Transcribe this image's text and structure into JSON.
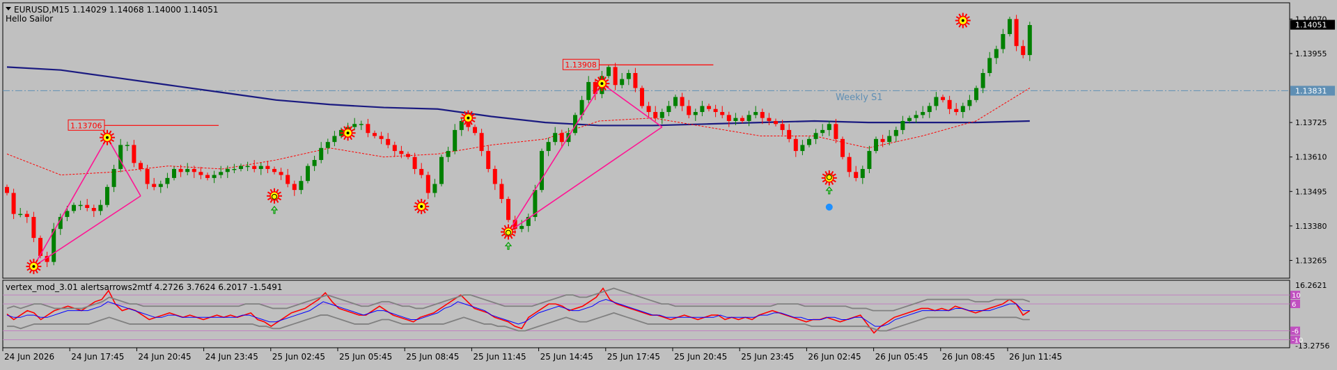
{
  "header": {
    "symbol_line": "EURUSD,M15  1.14029 1.14068 1.14000 1.14051",
    "subtitle": "Hello Sailor"
  },
  "colors": {
    "background": "#c0c0c0",
    "bull": "#008000",
    "bear": "#ff0000",
    "ma_long": "#1a1a80",
    "ma_short_dashed": "#ff0000",
    "zigzag": "#ff1493",
    "pivot_line": "#5f8fb4",
    "current_price_bg": "#000000",
    "osc_red": "#ff0000",
    "osc_blue": "#0000ff",
    "osc_band": "#808080",
    "osc_level": "#c080c0"
  },
  "chart_data": [
    {
      "type": "candlestick",
      "title": "EURUSD,M15",
      "ohlc_last": {
        "open": 1.14029,
        "high": 1.14068,
        "low": 1.14,
        "close": 1.14051
      },
      "y_ticks": [
        1.1407,
        1.13955,
        1.13725,
        1.1361,
        1.13495,
        1.1338,
        1.13265
      ],
      "y_tick_labels": [
        "1.14070",
        "1.13955",
        "1.13725",
        "1.13610",
        "1.13495",
        "1.13380",
        "1.13265"
      ],
      "ylim": [
        1.13215,
        1.14115
      ],
      "x_tick_labels": [
        "24 Jun 2026",
        "24 Jun 17:45",
        "24 Jun 20:45",
        "24 Jun 23:45",
        "25 Jun 02:45",
        "25 Jun 05:45",
        "25 Jun 08:45",
        "25 Jun 11:45",
        "25 Jun 14:45",
        "25 Jun 17:45",
        "25 Jun 20:45",
        "25 Jun 23:45",
        "26 Jun 02:45",
        "26 Jun 05:45",
        "26 Jun 08:45",
        "26 Jun 11:45"
      ],
      "current_price": 1.14051,
      "current_price_label": "1.14051",
      "pivot": {
        "label": "Weekly S1",
        "value": 1.13831,
        "value_label": "1.13831"
      },
      "price_labels": [
        {
          "text": "1.13706",
          "value": 1.13706,
          "bar": 15
        },
        {
          "text": "1.13908",
          "value": 1.13908,
          "bar": 89
        }
      ],
      "series": [
        {
          "name": "close",
          "values": [
            1.1349,
            1.1342,
            1.1342,
            1.1341,
            1.1334,
            1.1328,
            1.1326,
            1.1337,
            1.1341,
            1.1343,
            1.1345,
            1.1345,
            1.1344,
            1.1343,
            1.1345,
            1.1351,
            1.1357,
            1.1365,
            1.1365,
            1.1359,
            1.1357,
            1.1352,
            1.1351,
            1.1352,
            1.1354,
            1.1357,
            1.1356,
            1.1357,
            1.1356,
            1.1355,
            1.1354,
            1.1355,
            1.1356,
            1.1357,
            1.1357,
            1.1358,
            1.1358,
            1.1357,
            1.1358,
            1.1357,
            1.1356,
            1.1355,
            1.1352,
            1.135,
            1.1353,
            1.1358,
            1.136,
            1.1364,
            1.1366,
            1.1368,
            1.137,
            1.1371,
            1.1372,
            1.1372,
            1.1369,
            1.1368,
            1.1367,
            1.1365,
            1.1363,
            1.1362,
            1.1361,
            1.1357,
            1.1355,
            1.1349,
            1.1352,
            1.1361,
            1.1363,
            1.137,
            1.1373,
            1.1371,
            1.1369,
            1.1363,
            1.1357,
            1.1352,
            1.1347,
            1.134,
            1.1337,
            1.1338,
            1.1341,
            1.135,
            1.1363,
            1.1366,
            1.1369,
            1.1366,
            1.1369,
            1.1375,
            1.138,
            1.1386,
            1.1382,
            1.1388,
            1.1391,
            1.1385,
            1.1387,
            1.1389,
            1.1384,
            1.1378,
            1.1376,
            1.1374,
            1.1376,
            1.1378,
            1.1381,
            1.1378,
            1.1375,
            1.1376,
            1.1378,
            1.1377,
            1.1376,
            1.1375,
            1.1373,
            1.1374,
            1.1373,
            1.1375,
            1.1376,
            1.1374,
            1.1373,
            1.1372,
            1.137,
            1.1367,
            1.1363,
            1.1365,
            1.1367,
            1.1369,
            1.137,
            1.1372,
            1.1367,
            1.1361,
            1.1356,
            1.1354,
            1.1357,
            1.1363,
            1.1367,
            1.1366,
            1.1368,
            1.137,
            1.1373,
            1.1374,
            1.1375,
            1.1376,
            1.1378,
            1.1381,
            1.138,
            1.1377,
            1.1376,
            1.1378,
            1.138,
            1.1384,
            1.1389,
            1.1394,
            1.1397,
            1.1402,
            1.1407,
            1.1398,
            1.1395,
            1.1405
          ]
        }
      ],
      "ma_long": {
        "values": [
          1.1391,
          1.139,
          1.13875,
          1.1385,
          1.13825,
          1.138,
          1.13785,
          1.13775,
          1.1377,
          1.13745,
          1.13725,
          1.13715,
          1.13715,
          1.1372,
          1.13725,
          1.1373,
          1.13725,
          1.13725,
          1.13725,
          1.1373
        ]
      },
      "ma_short": {
        "values": [
          1.1362,
          1.1355,
          1.1356,
          1.1358,
          1.1357,
          1.136,
          1.1364,
          1.1361,
          1.1362,
          1.1365,
          1.1367,
          1.1373,
          1.1374,
          1.1371,
          1.1368,
          1.1368,
          1.1364,
          1.1368,
          1.1373,
          1.1384
        ]
      },
      "zigzag": [
        {
          "bar": 4,
          "value": 1.13245
        },
        {
          "bar": 15,
          "value": 1.13675
        },
        {
          "bar": 20,
          "value": 1.1348
        },
        {
          "bar": 4,
          "value": 1.13245
        },
        {
          "bar": 75,
          "value": 1.1336
        },
        {
          "bar": 89,
          "value": 1.13855
        },
        {
          "bar": 98,
          "value": 1.1371
        },
        {
          "bar": 75,
          "value": 1.1336
        }
      ],
      "signal_markers": [
        {
          "kind": "low",
          "bar": 4,
          "value": 1.13245
        },
        {
          "kind": "high",
          "bar": 15,
          "value": 1.13675
        },
        {
          "kind": "low",
          "bar": 40,
          "value": 1.1348
        },
        {
          "kind": "high",
          "bar": 51,
          "value": 1.1369
        },
        {
          "kind": "low",
          "bar": 62,
          "value": 1.13445
        },
        {
          "kind": "high",
          "bar": 69,
          "value": 1.1374
        },
        {
          "kind": "low",
          "bar": 75,
          "value": 1.1336
        },
        {
          "kind": "high",
          "bar": 89,
          "value": 1.13855
        },
        {
          "kind": "low",
          "bar": 123,
          "value": 1.1354
        },
        {
          "kind": "high",
          "bar": 143,
          "value": 1.14065
        }
      ],
      "up_arrows": [
        {
          "bar": 40,
          "value": 1.13445
        },
        {
          "bar": 75,
          "value": 1.13325
        },
        {
          "bar": 123,
          "value": 1.1351
        }
      ],
      "blue_dot": {
        "bar": 123,
        "value": 1.1348
      }
    },
    {
      "type": "line",
      "title": "vertex_mod_3.01 alertsarrows2mtf 4.2726 3.7624 6.2017 -1.5491",
      "y_tick_labels": [
        "16.2621",
        "-13.2756"
      ],
      "ylim": [
        -13.2756,
        16.2621
      ],
      "levels": [
        10,
        6,
        -6,
        -10
      ],
      "level_labels": [
        "10",
        "6",
        "-6",
        "-10"
      ],
      "series": [
        {
          "values": [
            1.5,
            -1,
            1,
            3,
            2,
            -1,
            1,
            3,
            4,
            5,
            4,
            3,
            5,
            7,
            8,
            12,
            6,
            3,
            4,
            3,
            1,
            -1,
            0,
            1,
            2,
            1,
            0,
            1,
            0,
            -1,
            0,
            1,
            0,
            1,
            0,
            1,
            2,
            -1,
            -2,
            -4,
            -2,
            0,
            2,
            3,
            4,
            6,
            8,
            11,
            7,
            4,
            3,
            2,
            1,
            1,
            3,
            5,
            3,
            1,
            0,
            -1,
            -2,
            0,
            1,
            2,
            4,
            6,
            8,
            10,
            7,
            4,
            3,
            2,
            0,
            -1,
            -2,
            -4,
            -5,
            0,
            2,
            4,
            6,
            6,
            5,
            3,
            4,
            5,
            7,
            9,
            13,
            8,
            6,
            5,
            4,
            3,
            2,
            1,
            1,
            0,
            -1,
            0,
            1,
            0,
            -1,
            0,
            1,
            1,
            -1,
            0,
            -1,
            0,
            -1,
            1,
            2,
            3,
            2,
            1,
            0,
            -1,
            -2,
            -1,
            -1,
            0,
            -1,
            -2,
            -1,
            0,
            1,
            -3,
            -7,
            -4,
            -2,
            0,
            1,
            2,
            3,
            4,
            4,
            3,
            4,
            3,
            5,
            4,
            3,
            2,
            3,
            4,
            5,
            6,
            8,
            6,
            1,
            3
          ]
        },
        {
          "values": [
            1,
            0,
            0,
            1,
            1,
            0,
            0,
            1,
            2,
            3,
            3,
            3,
            3,
            4,
            5,
            7,
            6,
            5,
            4,
            3,
            2,
            1,
            0,
            0,
            1,
            1,
            0,
            0,
            0,
            0,
            0,
            0,
            0,
            0,
            0,
            1,
            1,
            0,
            -1,
            -2,
            -2,
            -1,
            0,
            1,
            2,
            3,
            5,
            7,
            6,
            5,
            4,
            3,
            2,
            1,
            2,
            3,
            3,
            2,
            1,
            0,
            -1,
            -1,
            0,
            1,
            2,
            4,
            5,
            7,
            6,
            5,
            4,
            3,
            1,
            0,
            -1,
            -2,
            -3,
            -2,
            0,
            2,
            3,
            4,
            5,
            4,
            3,
            3,
            4,
            5,
            7,
            8,
            7,
            6,
            5,
            4,
            3,
            2,
            1,
            1,
            0,
            0,
            0,
            0,
            0,
            0,
            0,
            0,
            1,
            0,
            0,
            0,
            0,
            0,
            1,
            1,
            2,
            2,
            1,
            0,
            0,
            -1,
            -1,
            -1,
            0,
            0,
            -1,
            -1,
            0,
            0,
            -2,
            -4,
            -4,
            -3,
            -1,
            0,
            1,
            2,
            3,
            3,
            3,
            3,
            3,
            4,
            4,
            3,
            3,
            3,
            3,
            4,
            5,
            6,
            6,
            3,
            3
          ]
        },
        {
          "values": [
            4,
            5,
            4,
            5,
            6,
            6,
            5,
            4,
            4,
            4,
            4,
            4,
            5,
            6,
            7,
            9,
            8,
            7,
            6,
            6,
            5,
            5,
            5,
            5,
            5,
            5,
            5,
            5,
            5,
            5,
            5,
            5,
            5,
            5,
            5,
            6,
            6,
            6,
            5,
            4,
            4,
            4,
            5,
            6,
            7,
            8,
            9,
            10,
            9,
            8,
            7,
            6,
            5,
            5,
            6,
            7,
            7,
            6,
            5,
            5,
            4,
            4,
            5,
            6,
            7,
            8,
            9,
            10,
            10,
            9,
            8,
            7,
            6,
            5,
            5,
            5,
            5,
            5,
            6,
            7,
            8,
            9,
            10,
            10,
            9,
            9,
            10,
            11,
            12,
            13,
            12,
            11,
            10,
            9,
            8,
            7,
            6,
            6,
            5,
            5,
            5,
            5,
            5,
            5,
            5,
            5,
            5,
            5,
            5,
            5,
            5,
            5,
            5,
            6,
            6,
            6,
            6,
            5,
            5,
            5,
            5,
            5,
            5,
            5,
            4,
            4,
            4,
            3,
            3,
            3,
            3,
            4,
            5,
            6,
            7,
            8,
            8,
            8,
            8,
            8,
            8,
            8,
            7,
            7,
            7,
            8,
            8,
            8,
            8,
            8,
            7
          ]
        },
        {
          "values": [
            -4,
            -4,
            -5,
            -4,
            -3,
            -3,
            -3,
            -3,
            -3,
            -3,
            -3,
            -3,
            -3,
            -2,
            -1,
            0,
            -1,
            -2,
            -3,
            -3,
            -3,
            -3,
            -3,
            -3,
            -3,
            -3,
            -3,
            -3,
            -3,
            -3,
            -3,
            -3,
            -3,
            -3,
            -3,
            -3,
            -3,
            -4,
            -4,
            -5,
            -5,
            -4,
            -3,
            -2,
            -1,
            0,
            1,
            1,
            0,
            -1,
            -2,
            -3,
            -3,
            -3,
            -2,
            -1,
            -1,
            -2,
            -3,
            -3,
            -3,
            -3,
            -3,
            -3,
            -3,
            -2,
            -1,
            0,
            -1,
            -2,
            -3,
            -3,
            -4,
            -4,
            -5,
            -6,
            -6,
            -5,
            -4,
            -3,
            -2,
            -1,
            0,
            -1,
            -2,
            -2,
            -1,
            0,
            1,
            2,
            1,
            0,
            -1,
            -2,
            -3,
            -3,
            -3,
            -3,
            -3,
            -3,
            -3,
            -3,
            -3,
            -3,
            -3,
            -3,
            -3,
            -3,
            -3,
            -3,
            -3,
            -3,
            -3,
            -3,
            -3,
            -3,
            -3,
            -3,
            -4,
            -4,
            -4,
            -4,
            -4,
            -4,
            -4,
            -4,
            -4,
            -5,
            -6,
            -6,
            -5,
            -4,
            -3,
            -2,
            -1,
            0,
            0,
            0,
            0,
            0,
            0,
            0,
            0,
            0,
            0,
            0,
            0,
            0,
            0,
            -1,
            -1
          ]
        }
      ]
    }
  ]
}
